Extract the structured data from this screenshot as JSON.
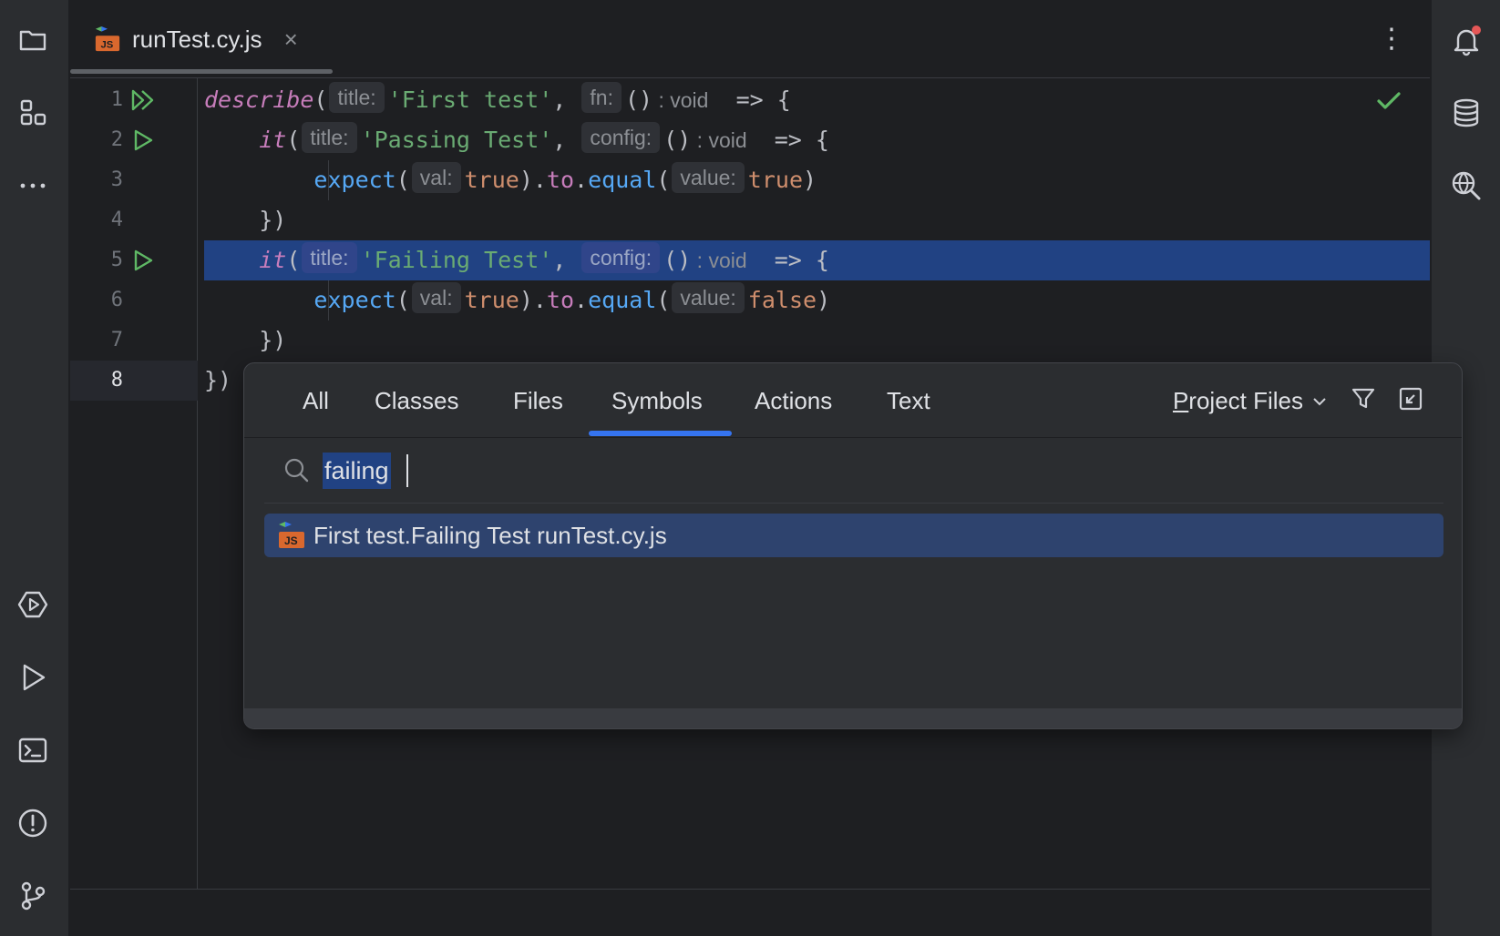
{
  "editor": {
    "tab": {
      "filename": "runTest.cy.js",
      "close_glyph": "×",
      "icon": "js-file-icon"
    },
    "menu_glyph": "⋮",
    "line_numbers": [
      "1",
      "2",
      "3",
      "4",
      "5",
      "6",
      "7",
      "8"
    ],
    "lines": [
      {
        "fn": "describe",
        "open": "(",
        "hint1": "title:",
        "str": "'First test'",
        "sep": ", ",
        "hint2": "fn:",
        "parens": "()",
        "rtype": " : void",
        "arrow": "  => {"
      },
      {
        "fn": "it",
        "open": "(",
        "hint1": "title:",
        "str": "'Passing Test'",
        "sep": ", ",
        "hint2": "config:",
        "parens": "()",
        "rtype": " : void",
        "arrow": "  => {"
      },
      {
        "call": "expect",
        "open": "(",
        "hint1": "val:",
        "lit1": "true",
        "mid1": ").",
        "prop": "to",
        "dot": ".",
        "call2": "equal",
        "open2": "(",
        "hint2": "value:",
        "lit2": "true",
        "close": ")"
      },
      {
        "text": "})"
      },
      {
        "fn": "it",
        "open": "(",
        "hint1": "title:",
        "str": "'Failing Test'",
        "sep": ", ",
        "hint2": "config:",
        "parens": "()",
        "rtype": " : void",
        "arrow": "  => {"
      },
      {
        "call": "expect",
        "open": "(",
        "hint1": "val:",
        "lit1": "true",
        "mid1": ").",
        "prop": "to",
        "dot": ".",
        "call2": "equal",
        "open2": "(",
        "hint2": "value:",
        "lit2": "false",
        "close": ")"
      },
      {
        "text": "})"
      },
      {
        "text": "})"
      }
    ]
  },
  "search_everywhere": {
    "tabs": [
      "All",
      "Classes",
      "Files",
      "Symbols",
      "Actions",
      "Text"
    ],
    "active_tab": "Symbols",
    "scope_prefix": "P",
    "scope_rest": "roject Files",
    "query": "failing",
    "results": [
      {
        "icon": "js-file-icon",
        "text": "First test.Failing Test runTest.cy.js"
      }
    ]
  },
  "colors": {
    "accent": "#3574f0",
    "selection": "#214283",
    "run_green": "#5fb865",
    "notification_badge": "#e55757"
  }
}
